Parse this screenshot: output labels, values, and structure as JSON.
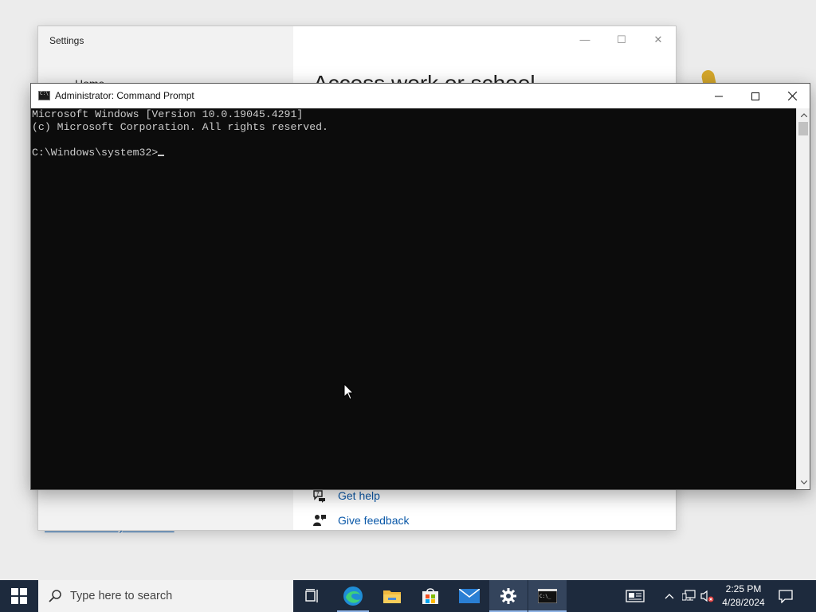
{
  "settings_window": {
    "title": "Settings",
    "sidebar_home": "Home",
    "heading": "Access work or school",
    "get_help": "Get help",
    "give_feedback": "Give feedback",
    "privacy_link": "Read our Privacy Statement"
  },
  "cmd_window": {
    "title": "Administrator: Command Prompt",
    "lines": [
      "Microsoft Windows [Version 10.0.19045.4291]",
      "(c) Microsoft Corporation. All rights reserved.",
      "",
      "C:\\Windows\\system32>"
    ],
    "colors": {
      "background": "#0c0c0c",
      "text": "#cccccc"
    }
  },
  "taskbar": {
    "search_placeholder": "Type here to search",
    "time": "2:25 PM",
    "date": "4/28/2024",
    "apps": [
      "task-view",
      "edge",
      "file-explorer",
      "microsoft-store",
      "mail",
      "settings",
      "command-prompt"
    ],
    "colors": {
      "background": "#1d2a3d",
      "accent": "#8fb4e6"
    }
  }
}
